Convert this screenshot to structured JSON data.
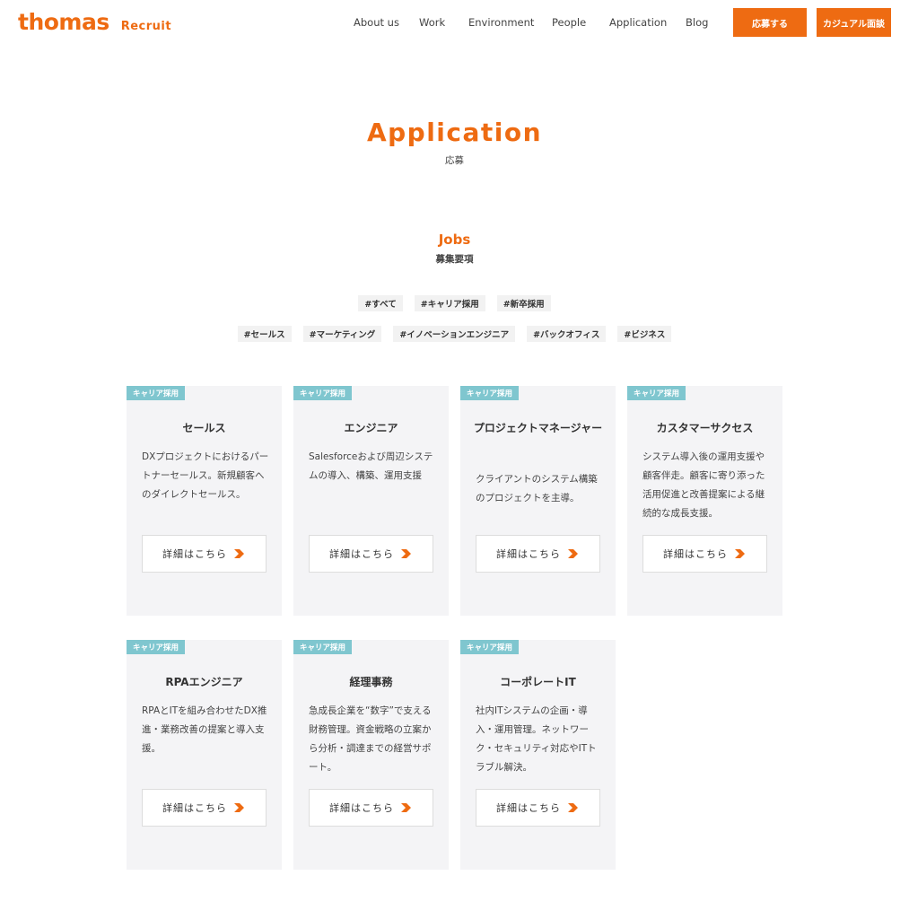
{
  "brand": {
    "logo_text": "thomas",
    "logo_sub": "Recruit",
    "accent_color": "#ee6b12",
    "badge_color": "#7fc6cf"
  },
  "nav": {
    "items": [
      "About us",
      "Work",
      "Environment",
      "People",
      "Application",
      "Blog"
    ],
    "apply_label": "応募する",
    "casual_label": "カジュアル面談"
  },
  "page": {
    "title": "Application",
    "subtitle": "応募"
  },
  "jobs": {
    "title": "Jobs",
    "subtitle": "募集要項",
    "tags_row1": [
      "#すべて",
      "#キャリア採用",
      "#新卒採用"
    ],
    "tags_row2": [
      "#セールス",
      "#マーケティング",
      "#イノベーションエンジニア",
      "#バックオフィス",
      "#ビジネス"
    ],
    "cards": [
      {
        "badge": "キャリア採用",
        "title": "セールス",
        "desc": "DXプロジェクトにおけるパートナーセールス。新規顧客へのダイレクトセールス。",
        "button": "詳細はこちら"
      },
      {
        "badge": "キャリア採用",
        "title": "エンジニア",
        "desc": "Salesforceおよび周辺システムの導入、構築、運用支援",
        "button": "詳細はこちら"
      },
      {
        "badge": "キャリア採用",
        "title": "プロジェクトマネージャー",
        "desc": "クライアントのシステム構築のプロジェクトを主導。",
        "button": "詳細はこちら"
      },
      {
        "badge": "キャリア採用",
        "title": "カスタマーサクセス",
        "desc": "システム導入後の運用支援や顧客伴走。顧客に寄り添った活用促進と改善提案による継続的な成長支援。",
        "button": "詳細はこちら"
      },
      {
        "badge": "キャリア採用",
        "title": "RPAエンジニア",
        "desc": "RPAとITを組み合わせたDX推進・業務改善の提案と導入支援。",
        "button": "詳細はこちら"
      },
      {
        "badge": "キャリア採用",
        "title": "経理事務",
        "desc": "急成長企業を“数字”で支える財務管理。資金戦略の立案から分析・調達までの経営サポート。",
        "button": "詳細はこちら"
      },
      {
        "badge": "キャリア採用",
        "title": "コーポレートIT",
        "desc": "社内ITシステムの企画・導入・運用管理。ネットワーク・セキュリティ対応やITトラブル解決。",
        "button": "詳細はこちら"
      }
    ]
  }
}
